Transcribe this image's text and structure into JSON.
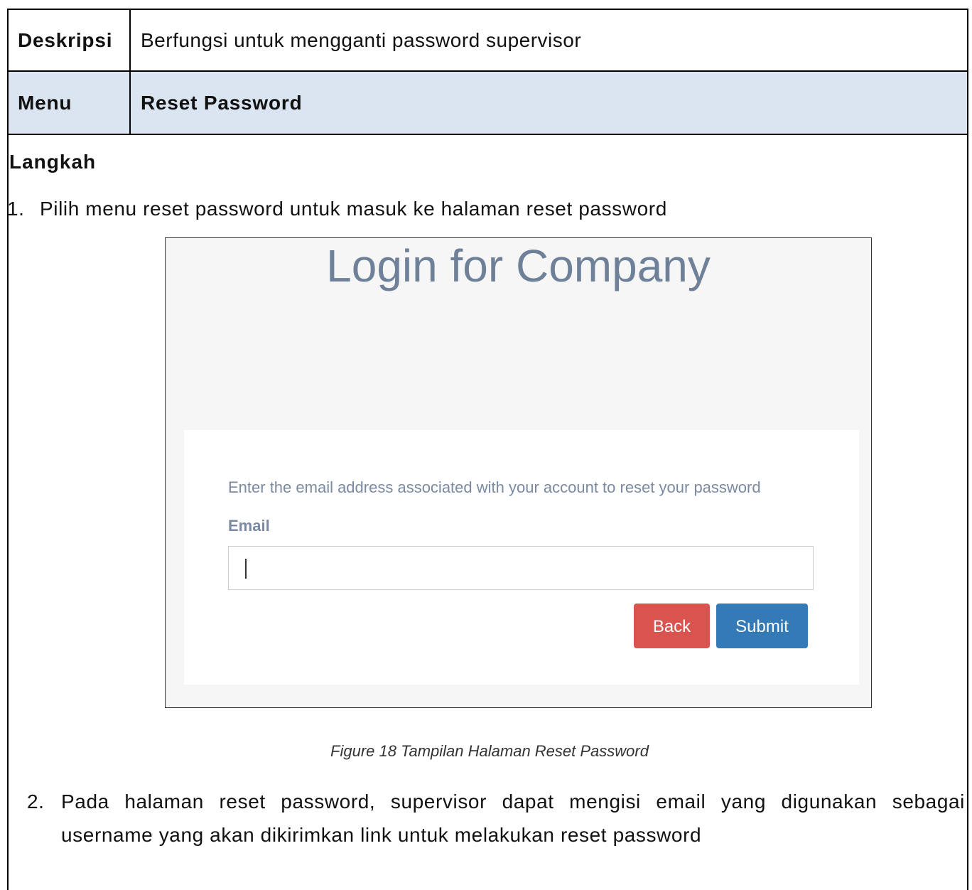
{
  "table": {
    "desc_label": "Deskripsi",
    "desc_value": "Berfungsi untuk mengganti password supervisor",
    "menu_label": "Menu",
    "menu_value": "Reset Password"
  },
  "steps": {
    "title": "Langkah",
    "step1_num": "1.",
    "step1_text": "Pilih menu reset password untuk masuk ke halaman reset password",
    "step2_num": "2.",
    "step2_text": "Pada halaman reset password, supervisor dapat mengisi email yang digunakan sebagai username yang akan dikirimkan link untuk melakukan reset password"
  },
  "screenshot": {
    "title": "Login for Company",
    "instruction": "Enter the email address associated with your account to reset your password",
    "email_label": "Email",
    "email_value": "",
    "back_label": "Back",
    "submit_label": "Submit"
  },
  "caption": "Figure 18 Tampilan Halaman Reset Password",
  "colors": {
    "menu_row_bg": "#dbe5f1",
    "title_color": "#6f8199",
    "back_button": "#d9534f",
    "submit_button": "#337ab7"
  }
}
